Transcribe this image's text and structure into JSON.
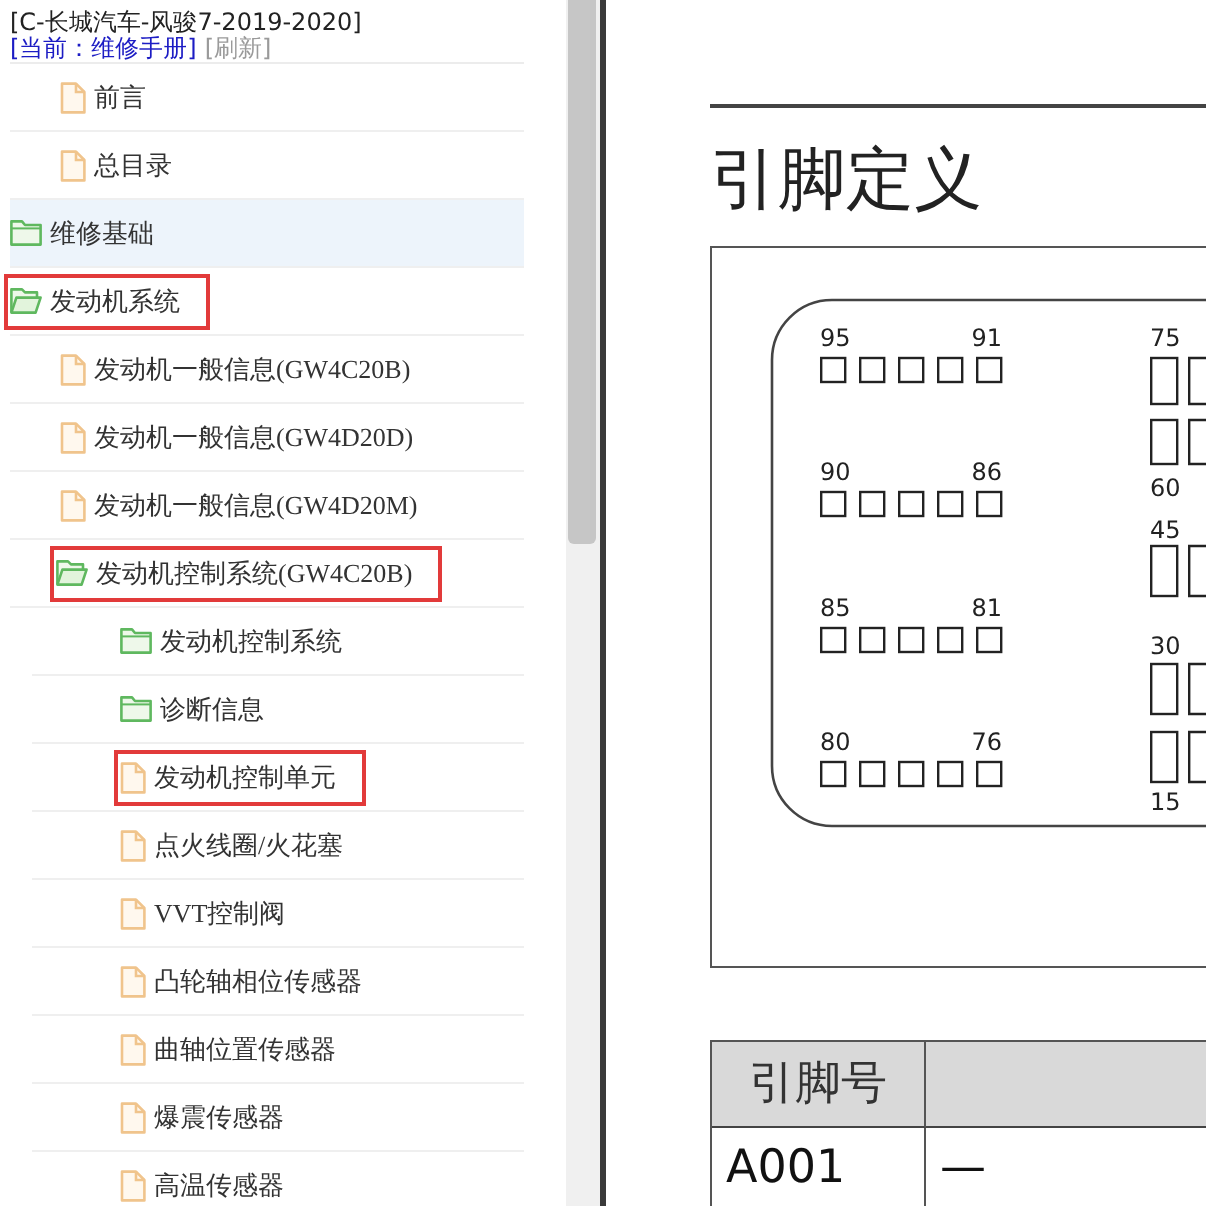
{
  "sidebar": {
    "header": {
      "title": "[C-长城汽车-风骏7-2019-2020]",
      "current": "[当前：维修手册]",
      "refresh": "[刷新]"
    },
    "tree": [
      {
        "kind": "file",
        "label": "前言",
        "selected": false,
        "marked": false
      },
      {
        "kind": "file",
        "label": "总目录",
        "selected": false,
        "marked": false
      },
      {
        "kind": "folder",
        "label": "维修基础",
        "selected": true,
        "marked": false,
        "expanded": false
      },
      {
        "kind": "folder",
        "label": "发动机系统",
        "selected": false,
        "marked": true,
        "expanded": true,
        "children": [
          {
            "kind": "file",
            "label": "发动机一般信息(GW4C20B)",
            "selected": false,
            "marked": false
          },
          {
            "kind": "file",
            "label": "发动机一般信息(GW4D20D)",
            "selected": false,
            "marked": false
          },
          {
            "kind": "file",
            "label": "发动机一般信息(GW4D20M)",
            "selected": false,
            "marked": false
          },
          {
            "kind": "folder",
            "label": "发动机控制系统(GW4C20B)",
            "selected": false,
            "marked": true,
            "expanded": true,
            "children": [
              {
                "kind": "folder",
                "label": "发动机控制系统",
                "selected": false,
                "marked": false,
                "expanded": false
              },
              {
                "kind": "folder",
                "label": "诊断信息",
                "selected": false,
                "marked": false,
                "expanded": false
              },
              {
                "kind": "file",
                "label": "发动机控制单元",
                "selected": false,
                "marked": true
              },
              {
                "kind": "file",
                "label": "点火线圈/火花塞",
                "selected": false,
                "marked": false
              },
              {
                "kind": "file",
                "label": "VVT控制阀",
                "selected": false,
                "marked": false
              },
              {
                "kind": "file",
                "label": "凸轮轴相位传感器",
                "selected": false,
                "marked": false
              },
              {
                "kind": "file",
                "label": "曲轴位置传感器",
                "selected": false,
                "marked": false
              },
              {
                "kind": "file",
                "label": "爆震传感器",
                "selected": false,
                "marked": false
              },
              {
                "kind": "file",
                "label": "高温传感器",
                "selected": false,
                "marked": false
              }
            ]
          }
        ]
      }
    ]
  },
  "document": {
    "title": "引脚定义",
    "connector": {
      "left_rows": [
        {
          "first": "95",
          "last": "91"
        },
        {
          "first": "90",
          "last": "86"
        },
        {
          "first": "85",
          "last": "81"
        },
        {
          "first": "80",
          "last": "76"
        }
      ],
      "right_labels": [
        "75",
        "60",
        "45",
        "30",
        "15"
      ]
    },
    "table": {
      "columns": [
        "引脚号"
      ],
      "rows": [
        [
          "A001",
          "—"
        ]
      ]
    }
  }
}
